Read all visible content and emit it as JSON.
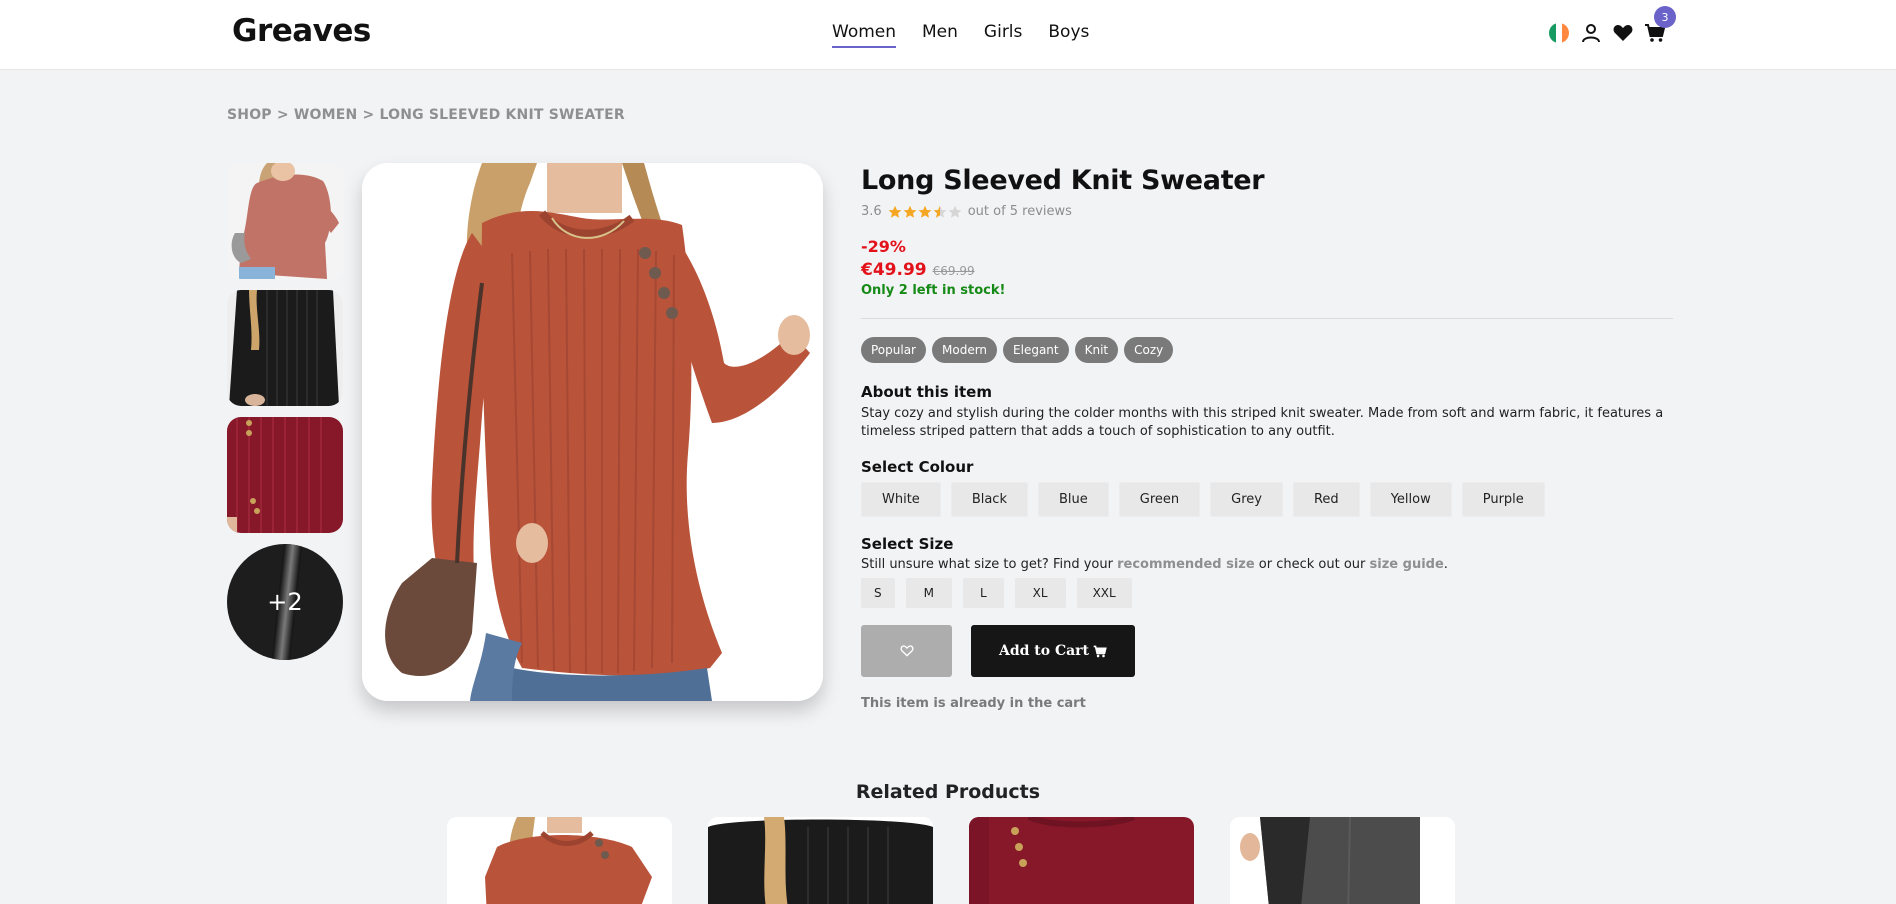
{
  "header": {
    "logo": "Greaves",
    "nav": [
      {
        "label": "Women",
        "active": true
      },
      {
        "label": "Men"
      },
      {
        "label": "Girls"
      },
      {
        "label": "Boys"
      }
    ],
    "cart_count": "3",
    "accent": "#6b63c9"
  },
  "breadcrumb": "SHOP > WOMEN > LONG SLEEVED KNIT SWEATER",
  "gallery": {
    "more_label": "+2"
  },
  "product": {
    "title": "Long Sleeved Knit Sweater",
    "rating_value": "3.6",
    "rating_numeric": 3.6,
    "rating_suffix": "out of 5 reviews",
    "discount": "-29%",
    "price": "€49.99",
    "old_price": "€69.99",
    "stock": "Only 2 left in stock!",
    "tags": [
      "Popular",
      "Modern",
      "Elegant",
      "Knit",
      "Cozy"
    ],
    "about_title": "About this item",
    "about_text": "Stay cozy and stylish during the colder months with this striped knit sweater. Made from soft and warm fabric, it features a timeless striped pattern that adds a touch of sophistication to any outfit.",
    "colour_title": "Select Colour",
    "colours": [
      "White",
      "Black",
      "Blue",
      "Green",
      "Grey",
      "Red",
      "Yellow",
      "Purple"
    ],
    "size_title": "Select Size",
    "size_hint_prefix": "Still unsure what size to get? Find your ",
    "size_hint_link1": "recommended size",
    "size_hint_mid": " or check out our ",
    "size_hint_link2": "size guide",
    "size_hint_end": ".",
    "sizes": [
      "S",
      "M",
      "L",
      "XL",
      "XXL"
    ],
    "add_to_cart": "Add to Cart",
    "in_cart_note": "This item is already in the cart"
  },
  "related": {
    "title": "Related Products"
  }
}
